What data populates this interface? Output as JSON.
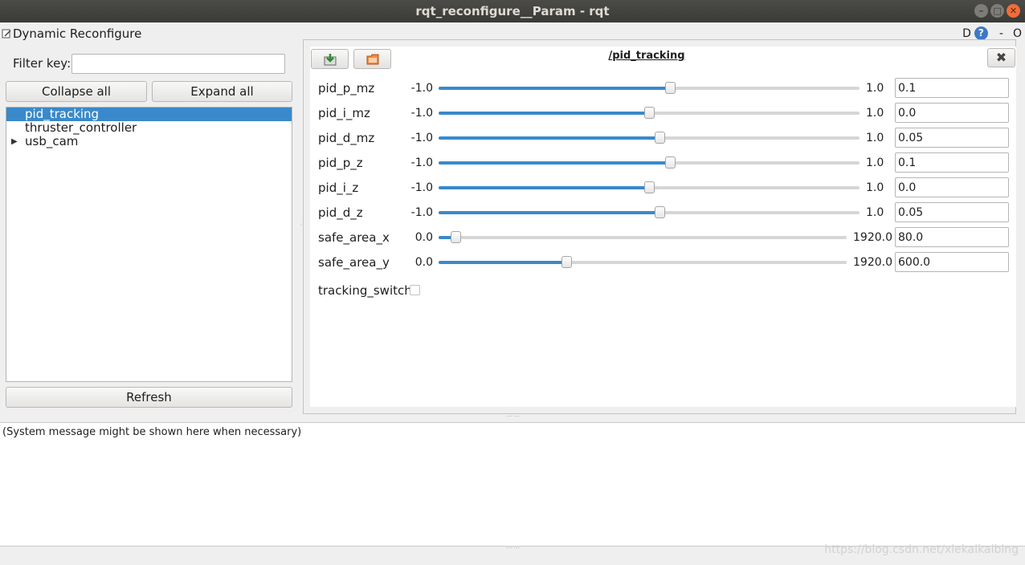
{
  "window": {
    "title": "rqt_reconfigure__Param - rqt",
    "controls": [
      "–",
      "□",
      "✕"
    ]
  },
  "plugin": {
    "title": "Dynamic Reconfigure",
    "ctrl_d": "D",
    "ctrl_help": "?",
    "ctrl_min": "-",
    "ctrl_o": "O"
  },
  "left": {
    "filter_label": "Filter key:",
    "filter_value": "",
    "collapse_label": "Collapse all",
    "expand_label": "Expand all",
    "refresh_label": "Refresh",
    "tree": [
      {
        "label": "pid_tracking",
        "selected": true,
        "expandable": false
      },
      {
        "label": "thruster_controller",
        "selected": false,
        "expandable": false
      },
      {
        "label": "usb_cam",
        "selected": false,
        "expandable": true
      }
    ]
  },
  "node": {
    "title": "/pid_tracking",
    "close_glyph": "✖"
  },
  "params": [
    {
      "name": "pid_p_mz",
      "min": "-1.0",
      "max": "1.0",
      "value": "0.1",
      "fraction": 0.55
    },
    {
      "name": "pid_i_mz",
      "min": "-1.0",
      "max": "1.0",
      "value": "0.0",
      "fraction": 0.5
    },
    {
      "name": "pid_d_mz",
      "min": "-1.0",
      "max": "1.0",
      "value": "0.05",
      "fraction": 0.525
    },
    {
      "name": "pid_p_z",
      "min": "-1.0",
      "max": "1.0",
      "value": "0.1",
      "fraction": 0.55
    },
    {
      "name": "pid_i_z",
      "min": "-1.0",
      "max": "1.0",
      "value": "0.0",
      "fraction": 0.5
    },
    {
      "name": "pid_d_z",
      "min": "-1.0",
      "max": "1.0",
      "value": "0.05",
      "fraction": 0.525
    },
    {
      "name": "safe_area_x",
      "min": "0.0",
      "max": "1920.0",
      "value": "80.0",
      "fraction": 0.0417
    },
    {
      "name": "safe_area_y",
      "min": "0.0",
      "max": "1920.0",
      "value": "600.0",
      "fraction": 0.3125
    }
  ],
  "bool_param": {
    "name": "tracking_switch",
    "checked": false
  },
  "status": {
    "message": "(System message might be shown here when necessary)"
  },
  "watermark": "https://blog.csdn.net/xiekaikaibing",
  "colors": {
    "accent": "#3a89ca",
    "titlebar": "#3c3b37",
    "close_button": "#f06d3a"
  }
}
